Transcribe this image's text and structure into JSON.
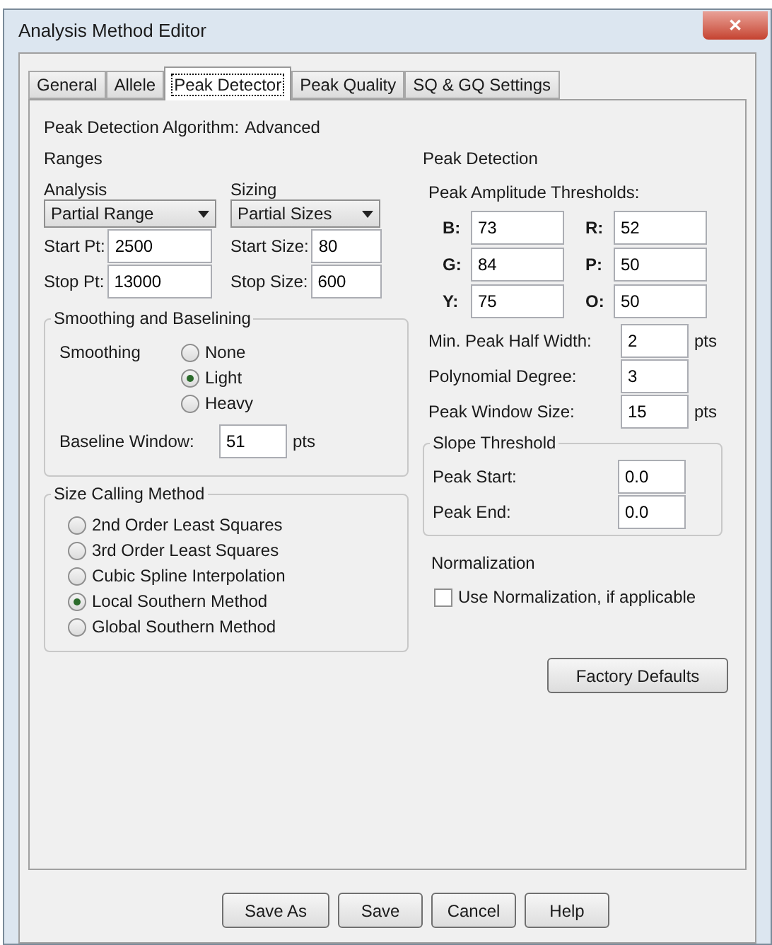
{
  "window": {
    "title": "Analysis Method Editor",
    "close": "✕"
  },
  "tabs": [
    {
      "label": "General",
      "selected": false
    },
    {
      "label": "Allele",
      "selected": false
    },
    {
      "label": "Peak Detector",
      "selected": true
    },
    {
      "label": "Peak Quality",
      "selected": false
    },
    {
      "label": "SQ & GQ Settings",
      "selected": false
    }
  ],
  "algorithm": {
    "label": "Peak Detection Algorithm:",
    "value": "Advanced"
  },
  "ranges": {
    "title": "Ranges",
    "columns": [
      {
        "heading": "Analysis",
        "dropdown": "Partial Range",
        "fields": [
          {
            "label": "Start Pt:",
            "value": "2500"
          },
          {
            "label": "Stop Pt:",
            "value": "13000"
          }
        ]
      },
      {
        "heading": "Sizing",
        "dropdown": "Partial Sizes",
        "fields": [
          {
            "label": "Start Size:",
            "value": "80"
          },
          {
            "label": "Stop Size:",
            "value": "600"
          }
        ]
      }
    ]
  },
  "smoothing": {
    "title": "Smoothing and Baselining",
    "label": "Smoothing",
    "options": [
      {
        "label": "None",
        "selected": false
      },
      {
        "label": "Light",
        "selected": true
      },
      {
        "label": "Heavy",
        "selected": false
      }
    ],
    "baseline": {
      "label": "Baseline Window:",
      "value": "51",
      "unit": "pts"
    }
  },
  "size_calling": {
    "title": "Size Calling Method",
    "options": [
      {
        "label": "2nd Order Least Squares",
        "selected": false
      },
      {
        "label": "3rd Order Least Squares",
        "selected": false
      },
      {
        "label": "Cubic Spline Interpolation",
        "selected": false
      },
      {
        "label": "Local Southern Method",
        "selected": true
      },
      {
        "label": "Global Southern Method",
        "selected": false
      }
    ]
  },
  "peak_detection": {
    "title": "Peak Detection",
    "thresholds_label": "Peak Amplitude Thresholds:",
    "thresholds": [
      {
        "label": "B:",
        "value": "73"
      },
      {
        "label": "R:",
        "value": "52"
      },
      {
        "label": "G:",
        "value": "84"
      },
      {
        "label": "P:",
        "value": "50"
      },
      {
        "label": "Y:",
        "value": "75"
      },
      {
        "label": "O:",
        "value": "50"
      }
    ],
    "params": [
      {
        "label": "Min. Peak Half Width:",
        "value": "2",
        "unit": "pts"
      },
      {
        "label": "Polynomial Degree:",
        "value": "3"
      },
      {
        "label": "Peak Window Size:",
        "value": "15",
        "unit": "pts"
      }
    ],
    "slope": {
      "title": "Slope Threshold",
      "fields": [
        {
          "label": "Peak Start:",
          "value": "0.0"
        },
        {
          "label": "Peak End:",
          "value": "0.0"
        }
      ]
    }
  },
  "normalization": {
    "title": "Normalization",
    "checkbox": {
      "label": "Use Normalization, if applicable",
      "checked": false
    }
  },
  "factory_defaults": "Factory Defaults",
  "buttons": [
    "Save As",
    "Save",
    "Cancel",
    "Help"
  ]
}
